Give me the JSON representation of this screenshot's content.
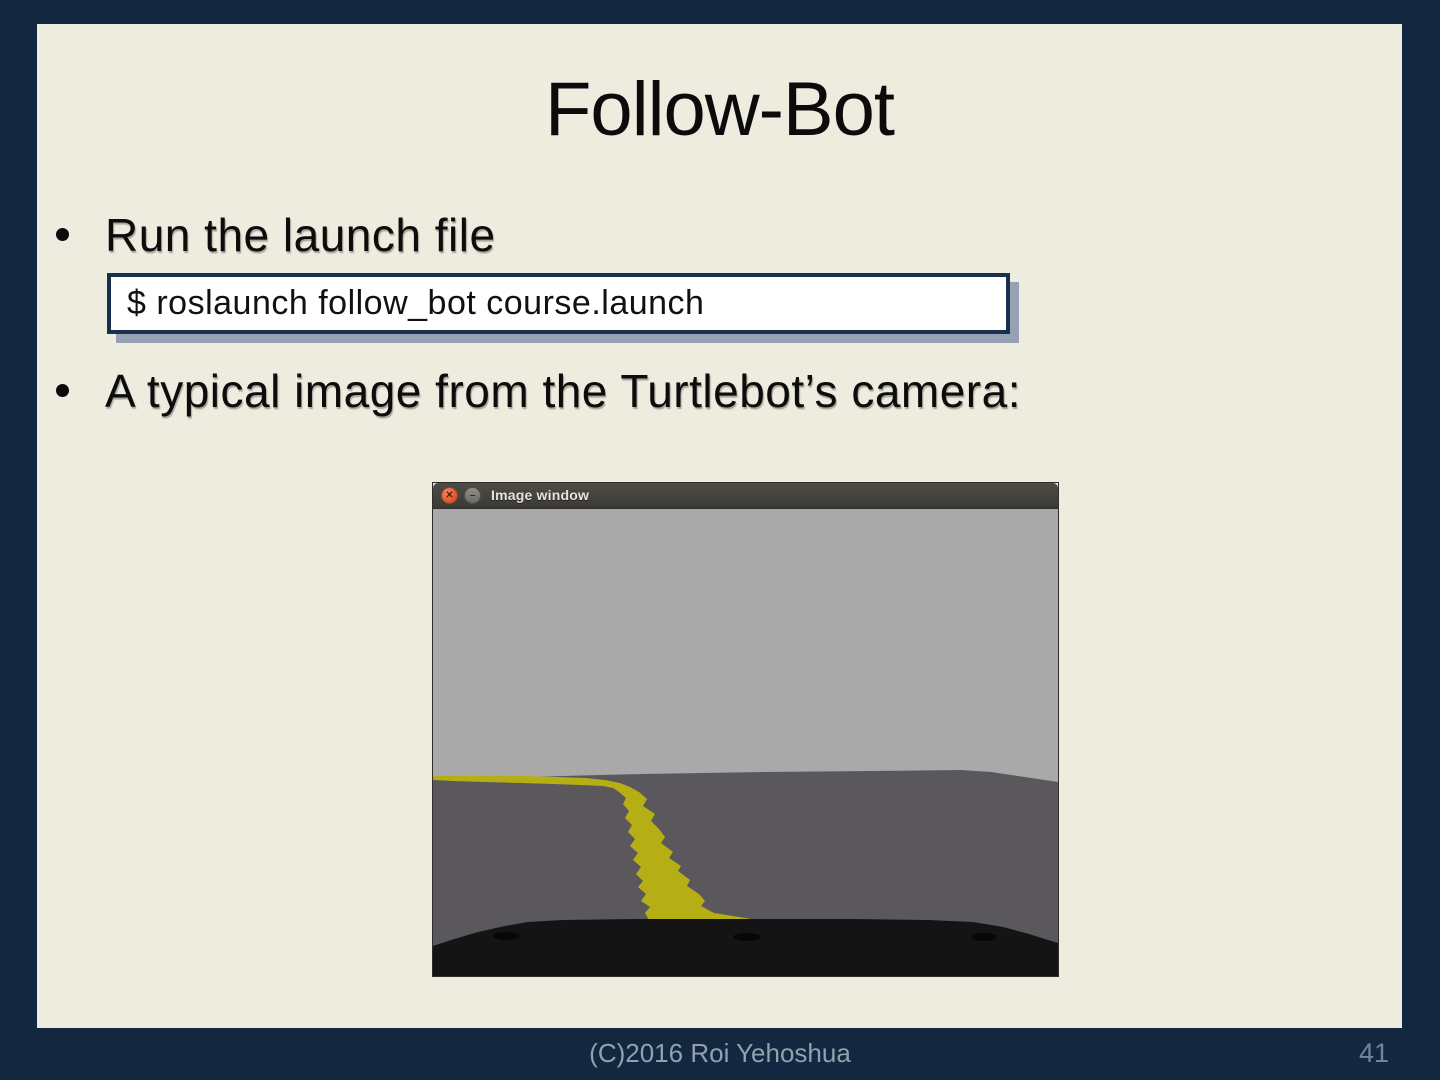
{
  "slide": {
    "title": "Follow-Bot",
    "bullets": [
      {
        "label": "Run the launch file"
      },
      {
        "label": "A typical image from the Turtlebot’s camera:"
      }
    ],
    "code_box": {
      "text": "$ roslaunch follow_bot course.launch"
    },
    "footer": {
      "copyright": "(C)2016 Roi Yehoshua",
      "page_number": "41"
    }
  },
  "image_window": {
    "title": "Image window",
    "controls": [
      {
        "name": "close",
        "icon": "close-icon",
        "glyph": "✕"
      },
      {
        "name": "minimize",
        "icon": "minimize-icon",
        "glyph": "–"
      }
    ],
    "scene": {
      "description": "Simulated Turtlebot camera view: light gray sky above a dark gray ground plane, a jagged yellow path curving from the horizon down to the robot's black base at the bottom edge",
      "colors": {
        "sky": "#a9a9a9",
        "ground": "#5a585c",
        "path": "#b6ae15",
        "base": "#141414",
        "base_spot": "#060606"
      }
    }
  },
  "theme": {
    "background": "#132740",
    "slide_background": "#eeebdf",
    "code_border": "#17304d",
    "code_shadow": "#97a1b4",
    "footer_text": "#93a0ae"
  }
}
